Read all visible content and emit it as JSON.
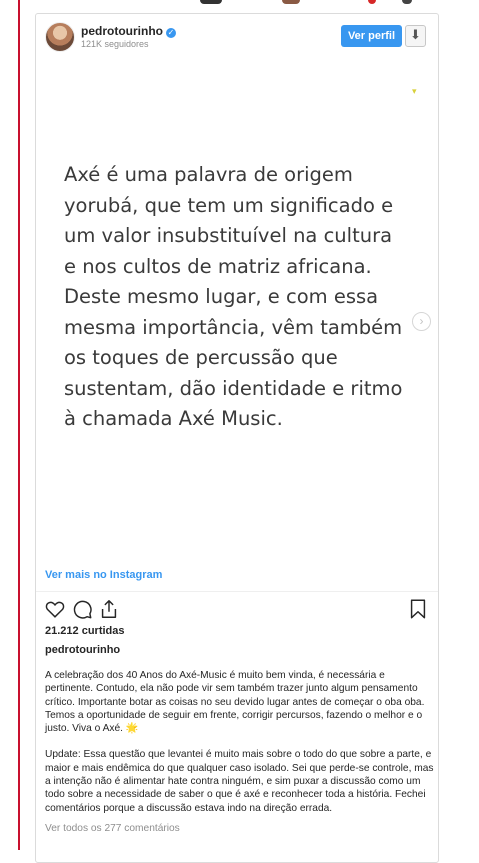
{
  "colors": {
    "accent": "#3897f0",
    "page_rule": "#c8102e",
    "text_primary": "#262626",
    "text_secondary": "#8e8e8e"
  },
  "header": {
    "username": "pedrotourinho",
    "followers": "121K seguidores",
    "view_profile": "Ver perfil",
    "icons": [
      "avatar",
      "verified-badge-icon",
      "download-icon"
    ]
  },
  "media": {
    "text": "Axé é uma palavra de origem yorubá, que tem um significado e um valor insubstituível na cultura e nos cultos de matriz africana. Deste mesmo lugar, e com essa mesma importância, vêm também os toques de percussão que sustentam, dão identidade e ritmo à chamada Axé Music.",
    "next_icon": "chevron-right-icon"
  },
  "footer": {
    "ver_mais": "Ver mais no Instagram",
    "action_icons": [
      "heart-icon",
      "comment-icon",
      "share-icon",
      "bookmark-icon"
    ],
    "likes": "21.212 curtidas",
    "owner": "pedrotourinho",
    "caption_p1": "A celebração dos 40 Anos do Axé-Music é muito bem vinda, é necessária e pertinente. Contudo, ela não pode vir sem também trazer junto algum pensamento crítico. Importante botar as coisas no seu devido lugar antes de começar o oba oba. Temos a oportunidade de seguir em frente, corrigir percursos, fazendo o melhor e o justo. Viva o Axé. 🌟",
    "caption_p2": "Update: Essa questão que levantei é muito mais sobre o todo do que sobre a parte, e maior e mais endêmica do que qualquer caso isolado. Sei que perde-se controle, mas a intenção não é alimentar hate contra ninguém, e sim puxar a discussão como um todo sobre a necessidade de saber o que é axé e reconhecer toda a história. Fechei comentários porque a discussão estava indo na direção errada.",
    "comments_link": "Ver todos os 277 comentários"
  }
}
